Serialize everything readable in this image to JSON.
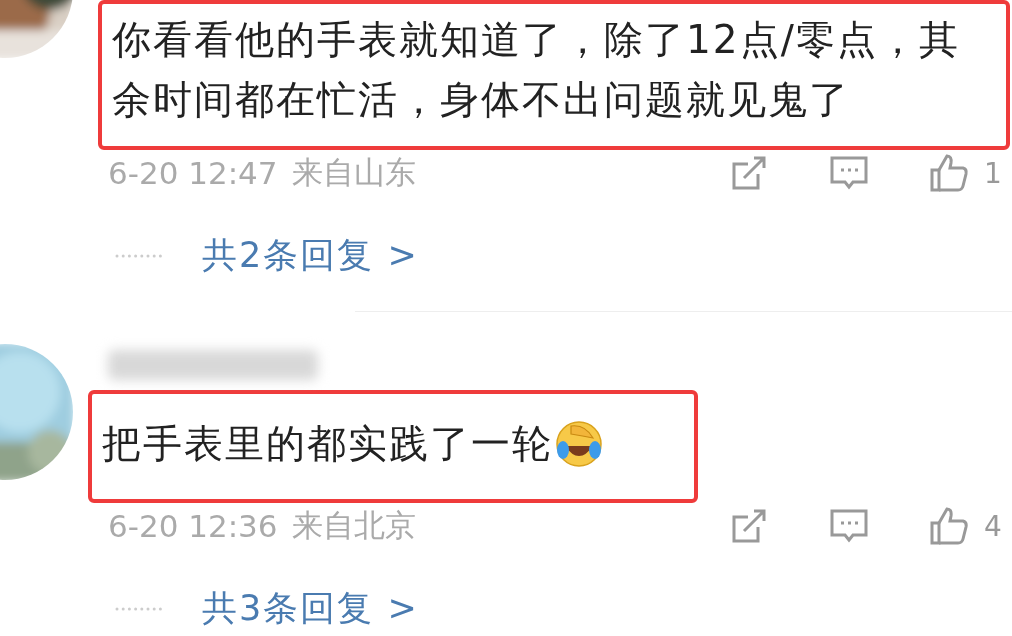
{
  "comments": [
    {
      "text": "你看看他的手表就知道了，除了12点/零点，其余时间都在忙活，身体不出问题就见鬼了",
      "highlighted": true,
      "time": "6-20 12:47",
      "location": "来自山东",
      "likes": "1",
      "replies": "共2条回复 >"
    },
    {
      "name_blurred": true,
      "text": "把手表里的都实践了一轮",
      "emoji": true,
      "highlighted": true,
      "time": "6-20 12:36",
      "location": "来自北京",
      "likes": "4",
      "replies": "共3条回复 >"
    }
  ]
}
